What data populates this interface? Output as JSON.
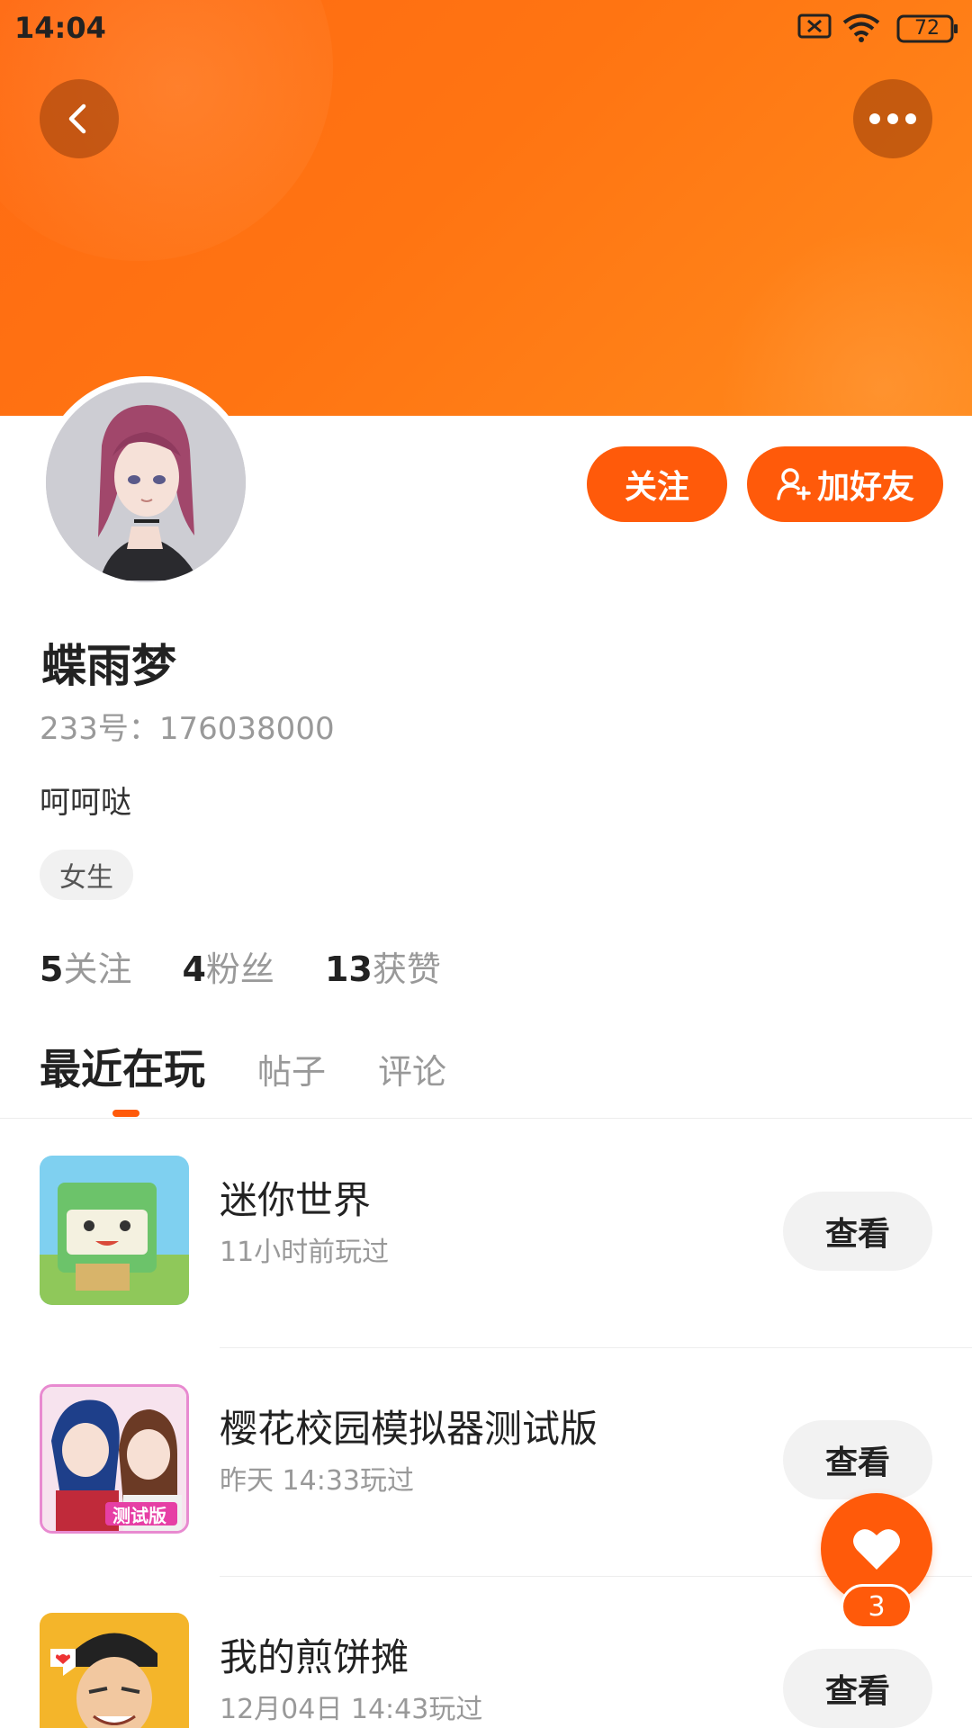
{
  "status_bar": {
    "time": "14:04",
    "battery": "72"
  },
  "header": {
    "back_icon": "chevron-left-icon",
    "more_icon": "more-dots-icon"
  },
  "profile": {
    "follow_label": "关注",
    "add_friend_label": "加好友",
    "name": "蝶雨梦",
    "uid": "233号：176038000",
    "bio": "呵呵哒",
    "gender_tag": "女生"
  },
  "stats": [
    {
      "num": "5",
      "label": "关注"
    },
    {
      "num": "4",
      "label": "粉丝"
    },
    {
      "num": "13",
      "label": "获赞"
    }
  ],
  "tabs": [
    "最近在玩",
    "帖子",
    "评论"
  ],
  "games": [
    {
      "title": "迷你世界",
      "played": "11小时前玩过",
      "action": "查看"
    },
    {
      "title": "樱花校园模拟器测试版",
      "played": "昨天 14:33玩过",
      "action": "查看",
      "badge": "测试版"
    },
    {
      "title": "我的煎饼摊",
      "played": "12月04日 14:43玩过",
      "action": "查看"
    }
  ],
  "fab": {
    "icon": "heart-icon",
    "count": "3"
  },
  "colors": {
    "accent": "#ff5a0a",
    "banner": "#ff7412"
  }
}
